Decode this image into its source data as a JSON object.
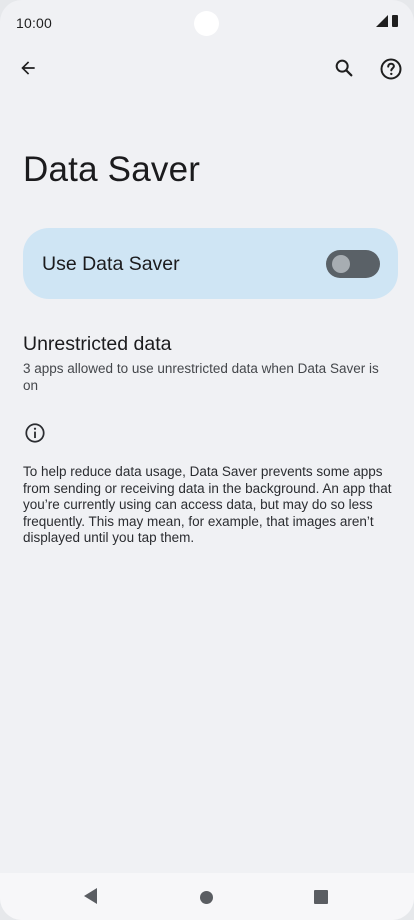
{
  "status_bar": {
    "time": "10:00",
    "icons": [
      "cellular-signal-icon",
      "battery-icon"
    ]
  },
  "app_bar": {
    "back_icon": "arrow-back-icon",
    "search_icon": "search-icon",
    "help_icon": "help-icon"
  },
  "page": {
    "title": "Data Saver"
  },
  "data_saver_toggle": {
    "label": "Use Data Saver",
    "enabled": false
  },
  "unrestricted_data": {
    "title": "Unrestricted data",
    "summary": "3 apps allowed to use unrestricted data when Data Saver is on"
  },
  "footer": {
    "icon": "info-icon",
    "text": "To help reduce data usage, Data Saver prevents some apps from sending or receiving data in the background. An app that you’re currently using can access data, but may do so less frequently. This may mean, for example, that images aren’t displayed until you tap them."
  },
  "navigation_bar": {
    "icons": [
      "nav-back-icon",
      "nav-home-icon",
      "nav-recents-icon"
    ]
  },
  "colors": {
    "background": "#f0f1f4",
    "toggle_card": "#cfe5f4",
    "switch_track_off": "#5a6167",
    "switch_thumb_off": "#a7adb2",
    "text_primary": "#1b1b1d",
    "text_secondary": "#44474b"
  }
}
